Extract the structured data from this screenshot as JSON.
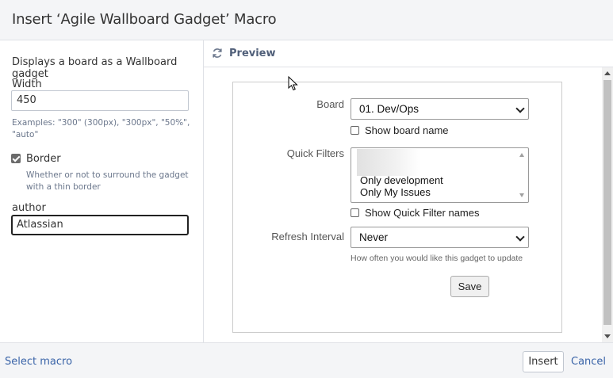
{
  "dialog": {
    "title": "Insert ‘Agile Wallboard Gadget’ Macro"
  },
  "params": {
    "description": "Displays a board as a Wallboard gadget",
    "width_label": "Width",
    "width_value": "450",
    "width_hint_line1": "Examples: \"300\" (300px), \"300px\", \"50%\",",
    "width_hint_line2": "\"auto\"",
    "border_label": "Border",
    "border_checked": true,
    "border_hint_line1": "Whether or not to surround the gadget",
    "border_hint_line2": "with a thin border",
    "author_label": "author",
    "author_value": "Atlassian"
  },
  "preview": {
    "title": "Preview",
    "icon": "refresh-icon"
  },
  "gadget": {
    "board_label": "Board",
    "board_value": "01. Dev/Ops",
    "show_board_name_label": "Show board name",
    "quick_filters_label": "Quick Filters",
    "quick_filter_options": [
      "Only development",
      "Only My Issues"
    ],
    "show_quick_filter_names_label": "Show Quick Filter names",
    "refresh_label": "Refresh Interval",
    "refresh_value": "Never",
    "refresh_hint": "How often you would like this gadget to update",
    "save_label": "Save"
  },
  "footer": {
    "select_macro": "Select macro",
    "insert": "Insert",
    "cancel": "Cancel"
  },
  "colors": {
    "link": "#3a64a8",
    "header_bg": "#f4f5f7",
    "border": "#dfe1e6"
  }
}
